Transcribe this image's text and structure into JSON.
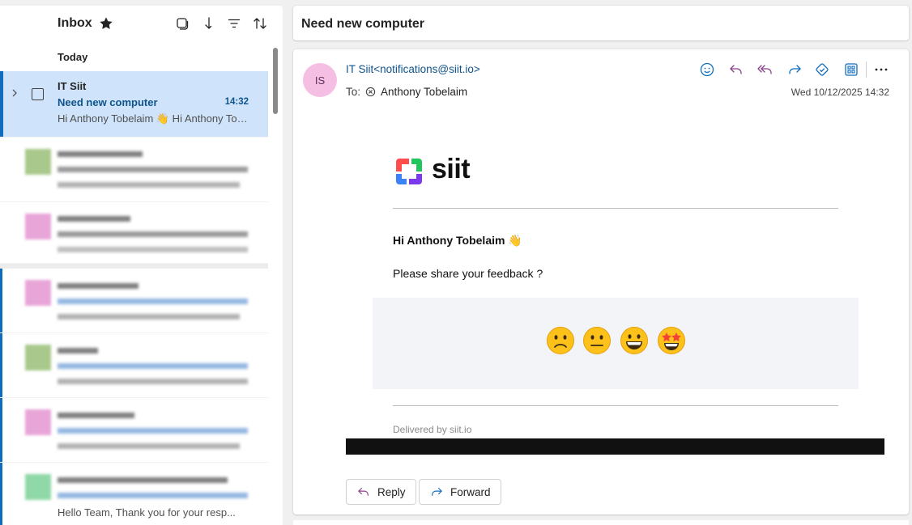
{
  "list": {
    "folder_title": "Inbox",
    "section_label": "Today",
    "selected_message": {
      "sender": "IT Siit",
      "subject": "Need new computer",
      "time": "14:32",
      "preview": "Hi Anthony Tobelaim 👋 Hi Anthony Tobelaim"
    },
    "last_visible_preview": "Hello Team, Thank you for your resp..."
  },
  "reading": {
    "subject": "Need new computer",
    "sender_initials": "IS",
    "sender_display": "IT Siit<notifications@siit.io>",
    "to_label": "To:",
    "to_name": "Anthony Tobelaim",
    "date": "Wed 10/12/2025 14:32",
    "body": {
      "logo_text": "siit",
      "greeting": "Hi Anthony Tobelaim 👋",
      "prompt": "Please share your feedback ?",
      "emojis": [
        "🙁",
        "😐",
        "😀",
        "🤩"
      ],
      "footer": "Delivered by siit.io"
    },
    "reply_label": "Reply",
    "forward_label": "Forward"
  },
  "colors": {
    "accent": "#0f6cbd",
    "selected_bg": "#cfe4fa",
    "avatar_bg": "#f4bfe3"
  }
}
